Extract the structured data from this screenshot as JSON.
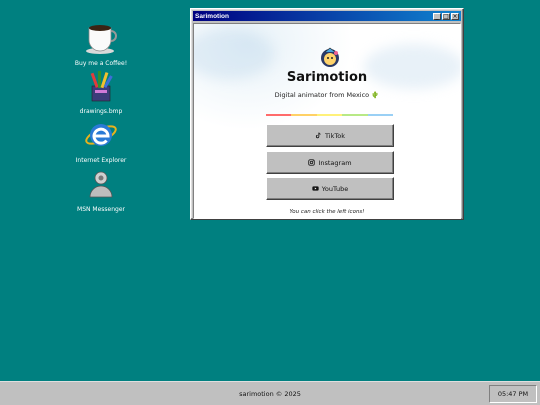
{
  "desktop": {
    "icons": [
      {
        "label": "Buy me a Coffee!",
        "icon": "coffee-cup-icon"
      },
      {
        "label": "drawings.bmp",
        "icon": "paint-brushes-icon"
      },
      {
        "label": "Internet Explorer",
        "icon": "internet-explorer-icon"
      },
      {
        "label": "MSN Messenger",
        "icon": "msn-messenger-icon"
      }
    ],
    "background_color": "#008080"
  },
  "window": {
    "title": "Sarimotion",
    "controls": [
      "_",
      "□",
      "×"
    ],
    "name": "Sarimotion",
    "tagline": "Digital animator from Mexico",
    "tagline_icon": "cactus-icon",
    "links": [
      {
        "label": "TikTok",
        "icon": "tiktok-icon"
      },
      {
        "label": "Instagram",
        "icon": "instagram-icon"
      },
      {
        "label": "YouTube",
        "icon": "youtube-icon"
      }
    ],
    "hint": "You can click the left icons!",
    "rainbow_colors": [
      "#ff6b6b",
      "#ffd166",
      "#fff17a",
      "#b8e986",
      "#9ad0f5"
    ]
  },
  "taskbar": {
    "center_text": "sarimotion © 2025",
    "clock": "05:47 PM"
  }
}
